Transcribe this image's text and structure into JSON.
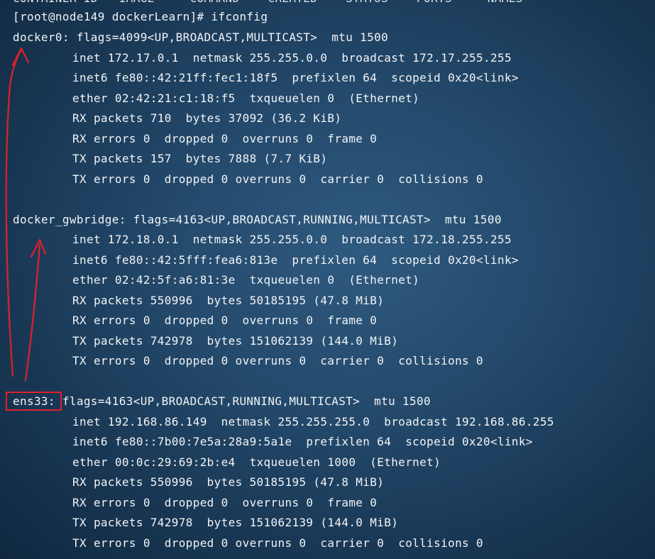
{
  "terminal": {
    "clipped_header": "CONTAINER ID   IMAGE     COMMAND    CREATED    STATUS    PORTS     NAMES",
    "prompt": "[root@node149 dockerLearn]# ifconfig",
    "interfaces": [
      {
        "header": "docker0: flags=4099<UP,BROADCAST,MULTICAST>  mtu 1500",
        "lines": [
          "inet 172.17.0.1  netmask 255.255.0.0  broadcast 172.17.255.255",
          "inet6 fe80::42:21ff:fec1:18f5  prefixlen 64  scopeid 0x20<link>",
          "ether 02:42:21:c1:18:f5  txqueuelen 0  (Ethernet)",
          "RX packets 710  bytes 37092 (36.2 KiB)",
          "RX errors 0  dropped 0  overruns 0  frame 0",
          "TX packets 157  bytes 7888 (7.7 KiB)",
          "TX errors 0  dropped 0 overruns 0  carrier 0  collisions 0"
        ]
      },
      {
        "header": "docker_gwbridge: flags=4163<UP,BROADCAST,RUNNING,MULTICAST>  mtu 1500",
        "lines": [
          "inet 172.18.0.1  netmask 255.255.0.0  broadcast 172.18.255.255",
          "inet6 fe80::42:5fff:fea6:813e  prefixlen 64  scopeid 0x20<link>",
          "ether 02:42:5f:a6:81:3e  txqueuelen 0  (Ethernet)",
          "RX packets 550996  bytes 50185195 (47.8 MiB)",
          "RX errors 0  dropped 0  overruns 0  frame 0",
          "TX packets 742978  bytes 151062139 (144.0 MiB)",
          "TX errors 0  dropped 0 overruns 0  carrier 0  collisions 0"
        ]
      },
      {
        "header": "ens33: flags=4163<UP,BROADCAST,RUNNING,MULTICAST>  mtu 1500",
        "lines": [
          "inet 192.168.86.149  netmask 255.255.255.0  broadcast 192.168.86.255",
          "inet6 fe80::7b00:7e5a:28a9:5a1e  prefixlen 64  scopeid 0x20<link>",
          "ether 00:0c:29:69:2b:e4  txqueuelen 1000  (Ethernet)",
          "RX packets 550996  bytes 50185195 (47.8 MiB)",
          "RX errors 0  dropped 0  overruns 0  frame 0",
          "TX packets 742978  bytes 151062139 (144.0 MiB)",
          "TX errors 0  dropped 0 overruns 0  carrier 0  collisions 0"
        ]
      }
    ]
  },
  "annotation": {
    "color": "#e0202a",
    "highlight_icon": "red-rectangle-highlight",
    "arrow_icon": "red-handdrawn-arrow"
  }
}
